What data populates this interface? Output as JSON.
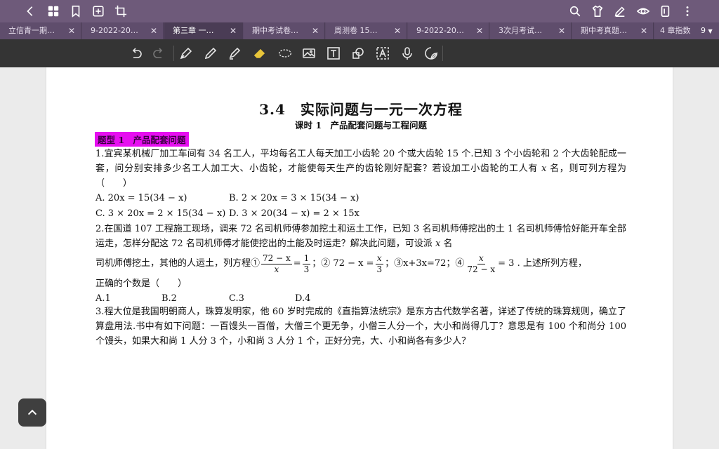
{
  "tabs": [
    {
      "label": "立信青一期…"
    },
    {
      "label": "9-2022-20…"
    },
    {
      "label": "第三章 一…"
    },
    {
      "label": "期中考试卷…"
    },
    {
      "label": "周测卷 15…"
    },
    {
      "label": "9-2022-20…"
    },
    {
      "label": "3次月考试…"
    },
    {
      "label": "期中考真题…"
    },
    {
      "label": "4 章指数"
    }
  ],
  "tab_count": "9",
  "active_tab_index": 2,
  "colors": {
    "topbar": "#6e5a7a",
    "tabbar": "#5a4966",
    "toolbar": "#343434",
    "highlight": "#e60ff0",
    "pen_color": "#f3f08a"
  },
  "icons": {
    "back": "chevron-left-icon",
    "grid": "grid-icon",
    "bookmark": "bookmark-icon",
    "add": "add-page-icon",
    "crop": "crop-icon",
    "search": "search-icon",
    "shirt": "theme-icon",
    "pen": "pen-edit-icon",
    "eye": "read-mode-icon",
    "pages": "pages-icon",
    "more": "more-icon"
  },
  "document": {
    "title": "3.4　实际问题与一元一次方程",
    "subtitle": "课时 1　产品配套问题与工程问题",
    "category": "题型 1　产品配套问题",
    "q1": {
      "text_before_var": "1.宜宾某机械厂加工车间有 34 名工人，平均每名工人每天加工小齿轮 20 个或大齿轮 15 个.已知 3 个小齿轮和 2 个大齿轮配成一套，问分别安排多少名工人加工大、小齿轮，才能使每天生产的齿轮刚好配套？若设加工小齿轮的工人有 ",
      "var": "x",
      "text_after_var": " 名，则可列方程为（　　）",
      "options": {
        "A": "A. 20x = 15(34 − x)",
        "B": "B. 2 × 20x = 3 × 15(34 − x)",
        "C": "C. 3 × 20x = 2 × 15(34 − x)",
        "D": "D. 3 × 20(34 − x) = 2 × 15x"
      }
    },
    "q2": {
      "text_before_var": "2.在国道 107 工程施工现场，调来 72 名司机师傅参加挖土和运土工作，已知 3 名司机师傅挖出的土 1 名司机师傅恰好能开车全部运走，怎样分配这 72 名司机师傅才能使挖出的土能及时运走？解决此问题，可设派 ",
      "var": "x",
      "text_after_var": " 名",
      "eq_lead": "司机师傅挖土，其他的人运土，列方程①",
      "f1_num": "72 − x",
      "f1_den": "x",
      "f1_rhs_num": "1",
      "f1_rhs_den": "3",
      "sep2": "；② 72 − x =",
      "f2_num": "x",
      "f2_den": "3",
      "eq3": "；③x+3x=72；④",
      "f4_num": "x",
      "f4_den": "72 − x",
      "eq_tail": "= 3 . 上述所列方程，",
      "closing": "正确的个数是（　　）",
      "options": {
        "A": "A.1",
        "B": "B.2",
        "C": "C.3",
        "D": "D.4"
      }
    },
    "q3": {
      "text": "3.程大位是我国明朝商人，珠算发明家，他 60 岁时完成的《直指算法统宗》是东方古代数学名著，详述了传统的珠算规则，确立了算盘用法.书中有如下问题：一百馒头一百僧，大僧三个更无争，小僧三人分一个，大小和尚得几丁？意思是有 100 个和尚分 100 个馒头，如果大和尚 1 人分 3 个，小和尚 3 人分 1 个，正好分完，大、小和尚各有多少人？"
    }
  }
}
